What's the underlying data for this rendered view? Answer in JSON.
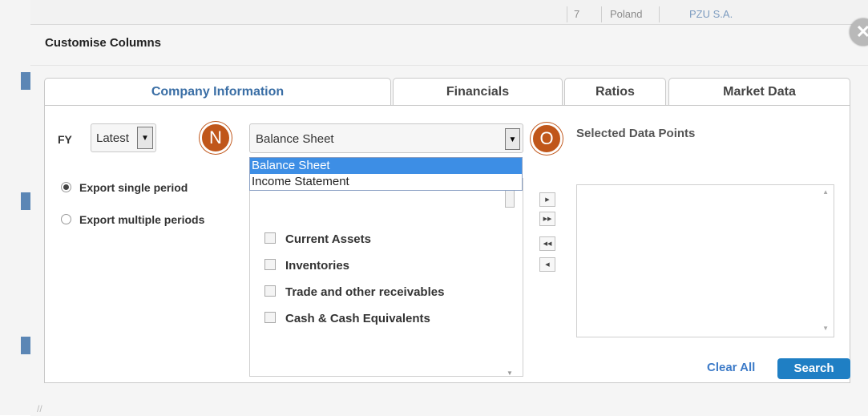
{
  "background": {
    "row_number": "7",
    "country": "Poland",
    "company": "PZU S.A."
  },
  "dialog": {
    "title": "Customise Columns",
    "close_glyph": "✕"
  },
  "tabs": [
    {
      "label": "Company Information",
      "active": true
    },
    {
      "label": "Financials",
      "active": false
    },
    {
      "label": "Ratios",
      "active": false
    },
    {
      "label": "Market Data",
      "active": false
    }
  ],
  "fy": {
    "label": "FY",
    "selected": "Latest",
    "arrow": "▼"
  },
  "export_options": [
    {
      "label": "Export single period",
      "checked": true
    },
    {
      "label": "Export multiple periods",
      "checked": false
    }
  ],
  "badges": {
    "n": "N",
    "o": "O"
  },
  "statement": {
    "selected": "Balance Sheet",
    "arrow": "▼",
    "options": [
      "Balance Sheet",
      "Income Statement"
    ]
  },
  "items": [
    "Current Assets",
    "Inventories",
    "Trade and other receivables",
    "Cash & Cash Equivalents"
  ],
  "move_buttons": [
    "▶",
    "▶▶",
    "◀◀",
    "◀"
  ],
  "selected_panel": {
    "title": "Selected Data Points"
  },
  "actions": {
    "clear_all": "Clear All",
    "search": "Search"
  },
  "colors": {
    "accent": "#1f7fc4",
    "badge": "#c0561a",
    "dropdown_highlight": "#3d8ee5"
  }
}
